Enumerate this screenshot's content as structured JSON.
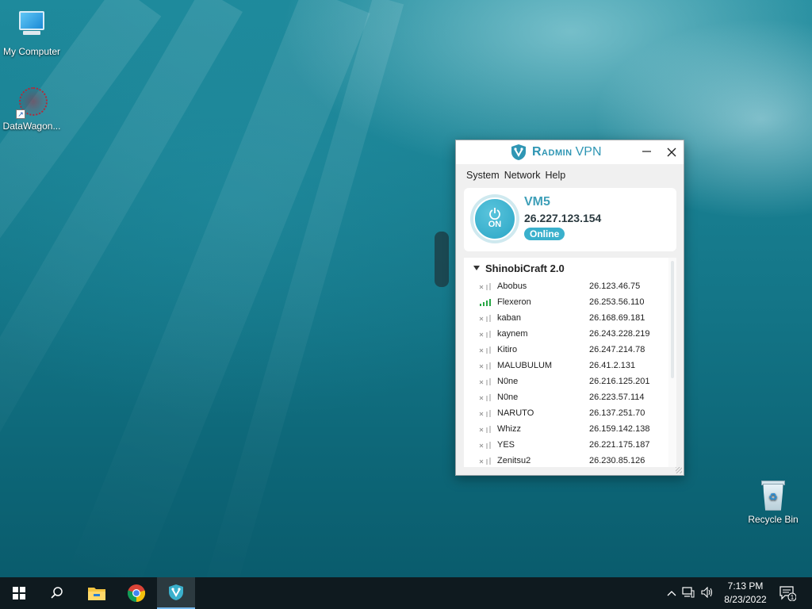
{
  "desktop": {
    "icons": [
      {
        "label": "My Computer"
      },
      {
        "label": "DataWagon..."
      },
      {
        "label": "Recycle Bin"
      }
    ]
  },
  "radmin": {
    "title_brand": "Radmin",
    "title_product": "VPN",
    "menu": [
      "System",
      "Network",
      "Help"
    ],
    "power_label": "ON",
    "computer_name": "VM5",
    "computer_ip": "26.227.123.154",
    "status": "Online",
    "network": {
      "name": "ShinobiCraft 2.0",
      "members": [
        {
          "name": "Abobus",
          "ip": "26.123.46.75",
          "online": false
        },
        {
          "name": "Flexeron",
          "ip": "26.253.56.110",
          "online": true
        },
        {
          "name": "kaban",
          "ip": "26.168.69.181",
          "online": false
        },
        {
          "name": "kaynem",
          "ip": "26.243.228.219",
          "online": false
        },
        {
          "name": "Kitiro",
          "ip": "26.247.214.78",
          "online": false
        },
        {
          "name": "MALUBULUM",
          "ip": "26.41.2.131",
          "online": false
        },
        {
          "name": "N0ne",
          "ip": "26.216.125.201",
          "online": false
        },
        {
          "name": "N0ne",
          "ip": "26.223.57.114",
          "online": false
        },
        {
          "name": "NARUTO",
          "ip": "26.137.251.70",
          "online": false
        },
        {
          "name": "Whizz",
          "ip": "26.159.142.138",
          "online": false
        },
        {
          "name": "YES",
          "ip": "26.221.175.187",
          "online": false
        },
        {
          "name": "Zenitsu2",
          "ip": "26.230.85.126",
          "online": false
        }
      ]
    }
  },
  "taskbar": {
    "clock_time": "7:13 PM",
    "clock_date": "8/23/2022",
    "notification_count": "1"
  },
  "colors": {
    "accent": "#2f96b4",
    "online_green": "#28a745",
    "taskbar_bg": "#0f1a1f"
  }
}
